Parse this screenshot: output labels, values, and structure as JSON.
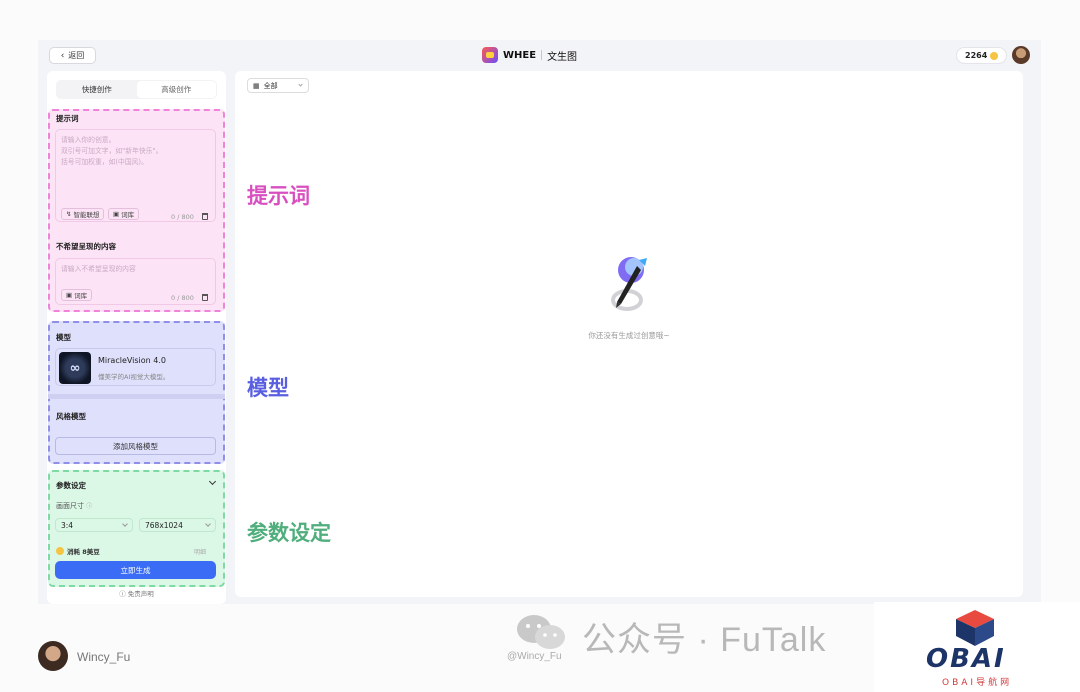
{
  "topbar": {
    "back_label": "返回",
    "brand_name": "WHEE",
    "page_title": "文生图",
    "credits": "2264"
  },
  "left": {
    "tabs": [
      {
        "label": "快捷创作"
      },
      {
        "label": "高级创作"
      }
    ],
    "prompt": {
      "title": "提示词",
      "placeholder_lines": [
        "请输入你的创意。",
        "双引号可加文字，如\"新年快乐\"。",
        "括号可加权重，如(中国风)。"
      ],
      "chip_smart": "智能联想",
      "chip_lexicon": "词库",
      "counter": "0 / 800"
    },
    "negative": {
      "title": "不希望呈现的内容",
      "placeholder": "请输入不希望呈现的内容",
      "chip_lexicon": "词库",
      "counter": "0 / 800"
    },
    "model": {
      "title": "模型",
      "name": "MiracleVision 4.0",
      "desc": "懂美学的AI视觉大模型。"
    },
    "style": {
      "title": "风格模型",
      "add_label": "添加风格模型"
    },
    "params": {
      "title": "参数设定",
      "size_label": "画面尺寸",
      "ratio": "3:4",
      "resolution": "768x1024",
      "cost": "消耗 8美豆",
      "detail": "明细",
      "generate": "立即生成",
      "disclaimer": "免责声明"
    }
  },
  "canvas": {
    "filter_label": "全部",
    "empty_text": "你还没有生成过创意哦~"
  },
  "annotations": {
    "prompt": "提示词",
    "model": "模型",
    "params": "参数设定",
    "colors": {
      "prompt": "#d84fc0",
      "model": "#5a5fe0",
      "params": "#4fae7c"
    }
  },
  "footer": {
    "author": "Wincy_Fu",
    "handle": "@Wincy_Fu",
    "wechat_text": "公众号 · FuTalk",
    "logo_text": "OBAI",
    "logo_sub": "OBAI导航网"
  }
}
